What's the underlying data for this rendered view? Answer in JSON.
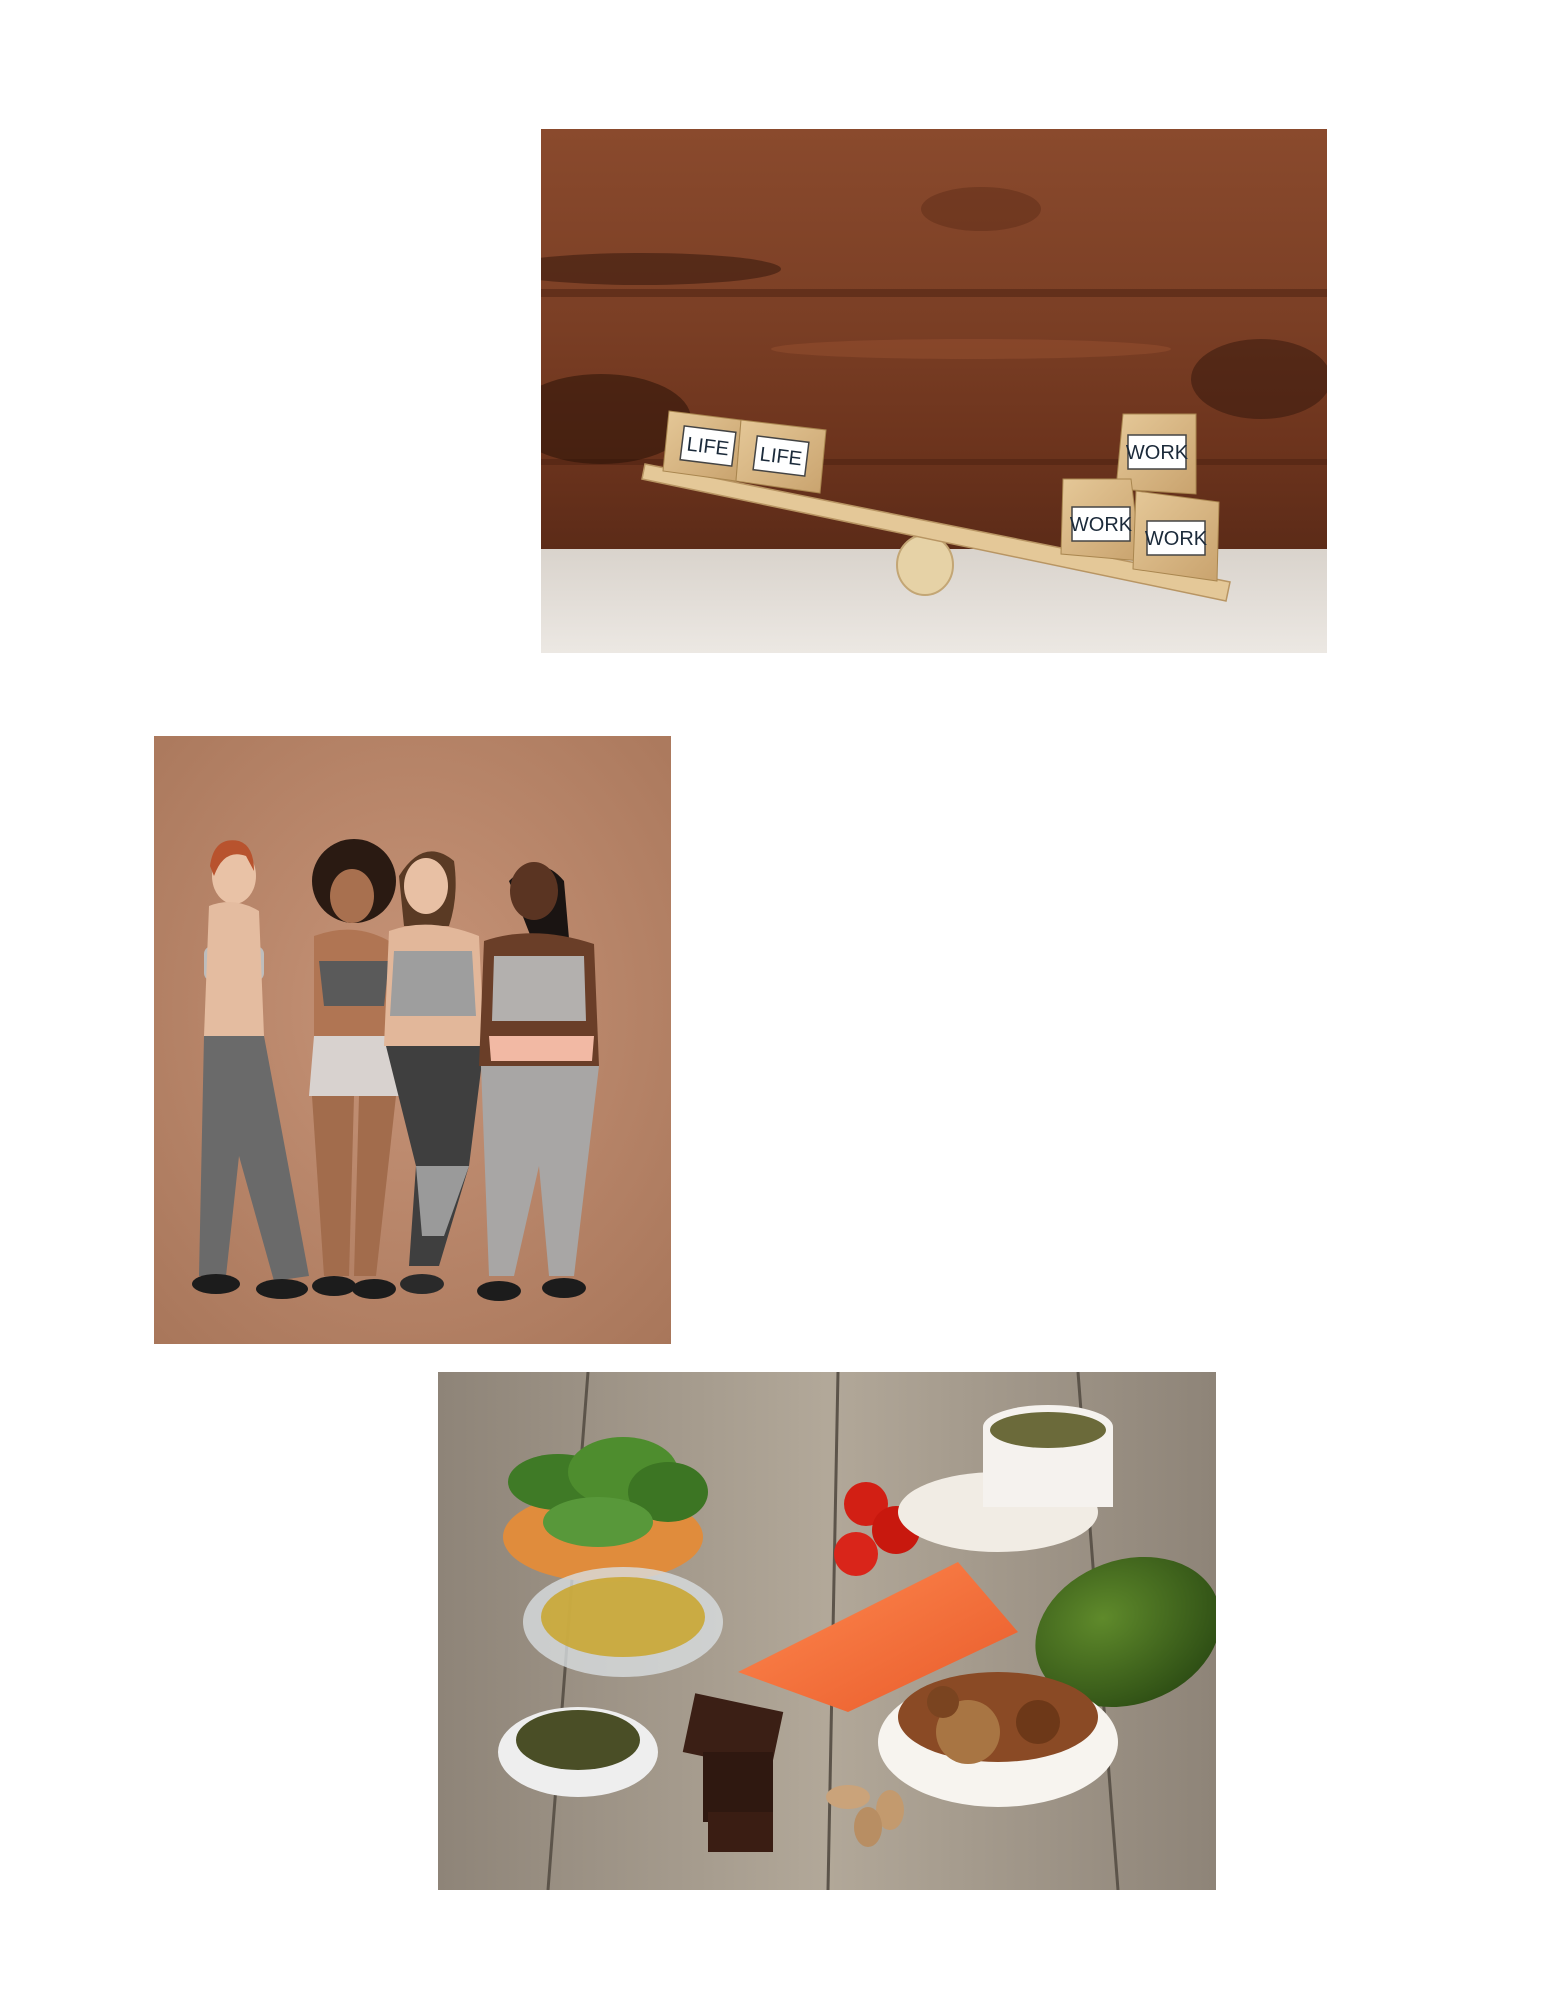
{
  "page": {
    "background": "#ffffff"
  },
  "images": [
    {
      "name": "work-life-balance-photo",
      "blocks_left": [
        "LIFE",
        "LIFE"
      ],
      "blocks_right": [
        "WORK",
        "WORK",
        "WORK"
      ]
    },
    {
      "name": "group-of-women-photo"
    },
    {
      "name": "healthy-food-photo"
    }
  ]
}
